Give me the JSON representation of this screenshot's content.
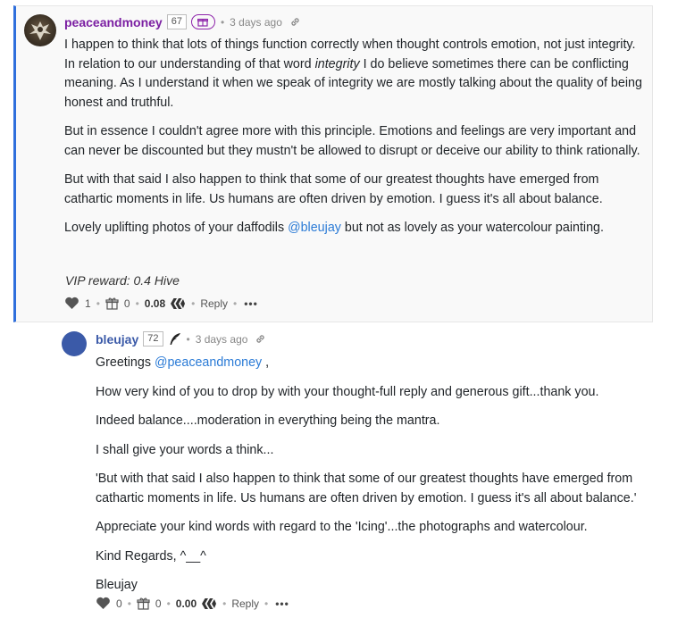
{
  "comment1": {
    "author": "peaceandmoney",
    "reputation": "67",
    "time": "3 days ago",
    "paragraphs": [
      [
        "I happen to think that lots of things function correctly when thought controls emotion, not just integrity. In relation to our understanding of that word ",
        "integrity",
        " I do believe sometimes there can be conflicting meaning. As I understand it when we speak of integrity we are mostly talking about the quality of being honest and truthful."
      ],
      "But in essence I couldn't agree more with this principle. Emotions and feelings are very important and can never be discounted but they mustn't be allowed to disrupt or deceive our ability to think rationally.",
      "But with that said I also happen to think that some of our greatest thoughts have emerged from cathartic moments in life. Us humans are often driven by emotion. I guess it's all about balance.",
      [
        "Lovely uplifting photos of your daffodils ",
        "@bleujay",
        " but not as lovely as your watercolour painting."
      ]
    ],
    "vip_reward": "VIP reward: 0.4 Hive",
    "votes": "1",
    "gifts": "0",
    "payout": "0.08",
    "reply_label": "Reply",
    "more_label": "•••"
  },
  "comment2": {
    "author": "bleujay",
    "reputation": "72",
    "time": "3 days ago",
    "greeting": [
      "Greetings ",
      "@peaceandmoney",
      " ,"
    ],
    "paragraphs": [
      "How very kind of you to drop by with your thought-full reply and generous gift...thank you.",
      "Indeed balance....moderation in everything being the mantra.",
      "I shall give your words a think...",
      "'But with that said I also happen to think that some of our greatest thoughts have emerged from cathartic moments in life. Us humans are often driven by emotion. I guess it's all about balance.'",
      "Appreciate your kind words with regard to the 'Icing'...the photographs and watercolour.",
      "Kind Regards, ^__^",
      "Bleujay"
    ],
    "votes": "0",
    "gifts": "0",
    "payout": "0.00",
    "reply_label": "Reply",
    "more_label": "•••"
  },
  "colors": {
    "author1": "#7b1fa2",
    "author2": "#3b5aa8",
    "mention": "#2b7bd6",
    "accent_border": "#2f6fdc"
  },
  "icons": [
    "heart-icon",
    "gift-icon",
    "hive-icon",
    "link-icon",
    "gift-badge-icon",
    "quill-icon",
    "more-icon"
  ]
}
